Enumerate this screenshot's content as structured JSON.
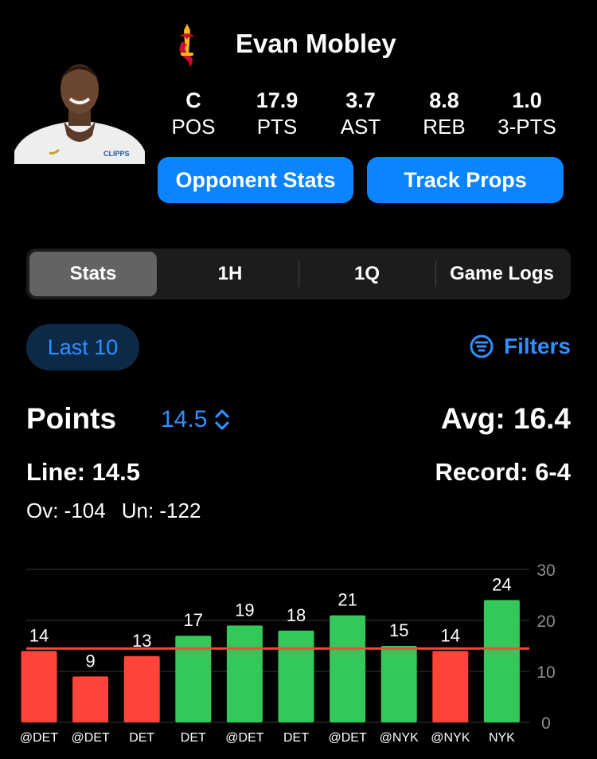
{
  "player": {
    "name": "Evan Mobley",
    "team_logo_icon": "cavaliers-sword-logo-icon",
    "avatar_icon": "player-headshot-icon",
    "stats": [
      {
        "value": "C",
        "label": "POS"
      },
      {
        "value": "17.9",
        "label": "PTS"
      },
      {
        "value": "3.7",
        "label": "AST"
      },
      {
        "value": "8.8",
        "label": "REB"
      },
      {
        "value": "1.0",
        "label": "3-PTS"
      }
    ]
  },
  "buttons": {
    "opponent": "Opponent Stats",
    "track": "Track Props",
    "accent": "#0a84ff"
  },
  "tabs": [
    {
      "label": "Stats",
      "active": true
    },
    {
      "label": "1H",
      "active": false
    },
    {
      "label": "1Q",
      "active": false
    },
    {
      "label": "Game Logs",
      "active": false
    }
  ],
  "filters": {
    "range": "Last 10",
    "filters_label": "Filters",
    "filter_icon": "filter-lines-icon"
  },
  "prop": {
    "stat": "Points",
    "line_select": "14.5",
    "chevron_icon": "up-down-chevron-icon",
    "avg": "Avg: 16.4",
    "line": "Line: 14.5",
    "record": "Record: 6-4",
    "over": "Ov: -104",
    "under": "Un: -122"
  },
  "chart_data": {
    "type": "bar",
    "categories": [
      "@DET",
      "@DET",
      "DET",
      "DET",
      "@DET",
      "DET",
      "@DET",
      "@NYK",
      "@NYK",
      "NYK"
    ],
    "values": [
      14,
      9,
      13,
      17,
      19,
      18,
      21,
      15,
      14,
      24
    ],
    "line": 14.5,
    "ylim": [
      0,
      30
    ],
    "yticks": [
      0,
      10,
      20,
      30
    ],
    "grid": true,
    "colors": {
      "over": "#34c759",
      "under": "#ff453a",
      "line": "#ff453a"
    }
  }
}
